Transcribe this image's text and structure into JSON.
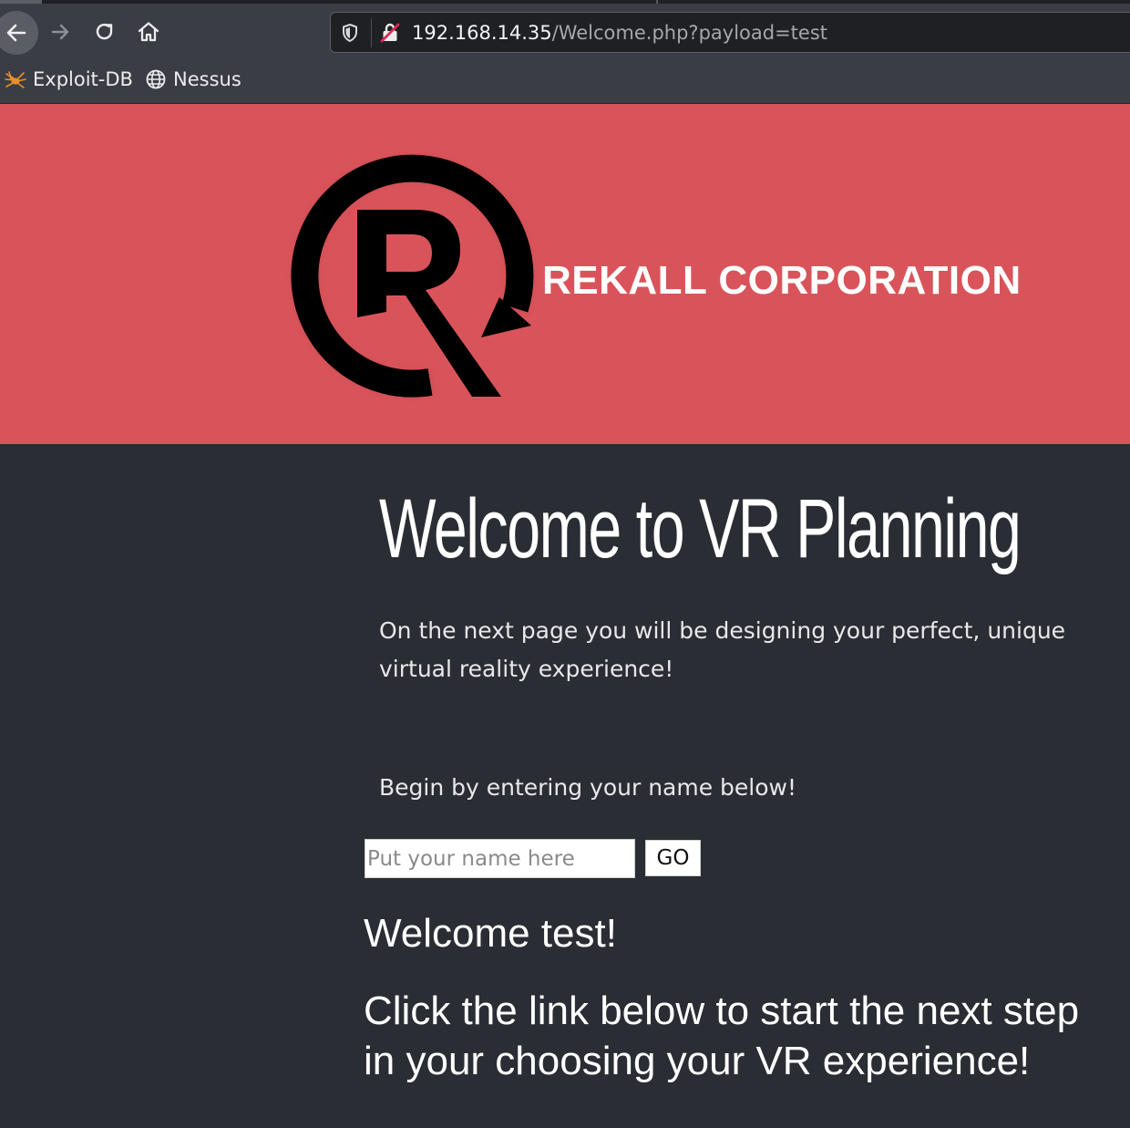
{
  "browser": {
    "url_host": "192.168.14.35",
    "url_path": "/Welcome.php?payload=test",
    "nav_icons": [
      "back-arrow",
      "forward-arrow",
      "reload",
      "home"
    ],
    "url_icons": [
      "tracking-shield",
      "insecure-lock"
    ],
    "bookmarks": [
      {
        "label": "Exploit-DB",
        "icon": "spider-icon"
      },
      {
        "label": "Nessus",
        "icon": "globe-icon"
      }
    ]
  },
  "header": {
    "logo": "Rekall R logo",
    "company_name": "REKALL CORPORATION",
    "background_color": "#d9545a"
  },
  "main": {
    "heading": "Welcome to VR Planning",
    "intro": "On the next  page you will be designing your perfect, unique virtual reality experience!",
    "begin": "Begin by entering your name below!",
    "name_placeholder": "Put your name here",
    "go_label": "GO",
    "welcome": "Welcome test!",
    "next_step": "Click the link below to start the next step in your choosing your VR experience!",
    "background_color": "#2a2d33"
  }
}
